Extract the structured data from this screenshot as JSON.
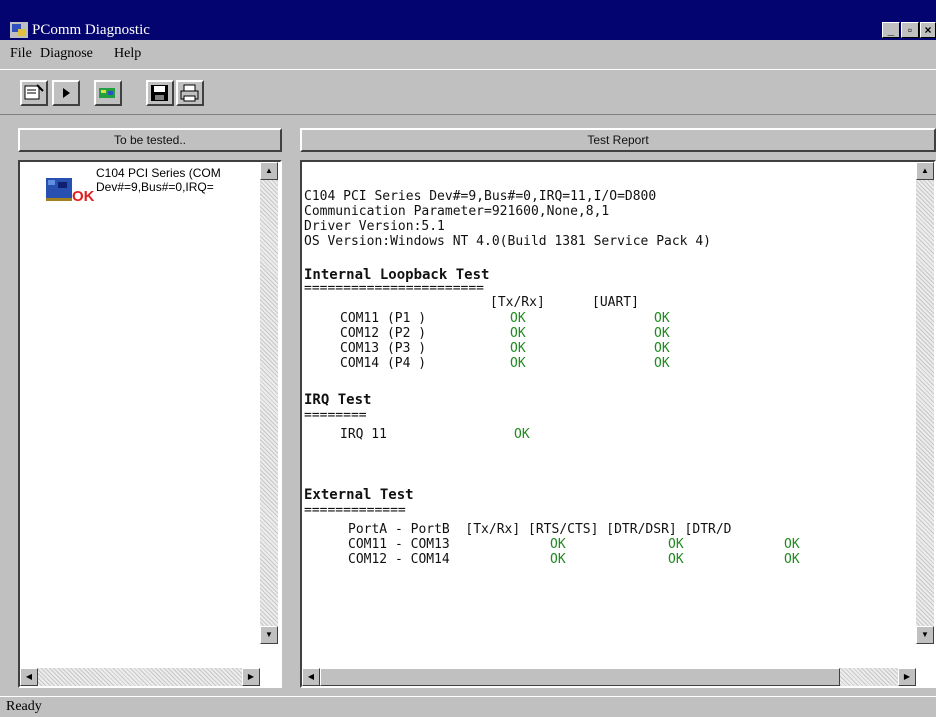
{
  "window": {
    "title": "PComm Diagnostic",
    "minimize_label": "_",
    "maximize_label": "▫",
    "close_label": "×"
  },
  "menu": [
    "File",
    "Diagnose",
    "Help"
  ],
  "toolbar": {
    "icons": [
      "properties-icon",
      "run-icon",
      "add-board-icon",
      "save-icon",
      "print-icon"
    ]
  },
  "left_panel": {
    "header": "To be tested..",
    "device": {
      "line1": "C104 PCI Series (COM",
      "line2": "Dev#=9,Bus#=0,IRQ=",
      "badge": "OK"
    }
  },
  "right_panel": {
    "header": "Test Report",
    "report": {
      "info_lines": [
        "C104 PCI Series Dev#=9,Bus#=0,IRQ=11,I/O=D800",
        "Communication Parameter=921600,None,8,1",
        "Driver Version:5.1",
        "OS Version:Windows NT 4.0(Build 1381 Service Pack 4)"
      ],
      "internal_title": "Internal Loopback Test",
      "internal_rule": "=======================",
      "internal_col1": "[Tx/Rx]",
      "internal_col2": "[UART]",
      "internal_rows": [
        {
          "port": "COM11 (P1 )",
          "txrx": "OK",
          "uart": "OK"
        },
        {
          "port": "COM12 (P2 )",
          "txrx": "OK",
          "uart": "OK"
        },
        {
          "port": "COM13 (P3 )",
          "txrx": "OK",
          "uart": "OK"
        },
        {
          "port": "COM14 (P4 )",
          "txrx": "OK",
          "uart": "OK"
        }
      ],
      "irq_title": "IRQ Test",
      "irq_rule": "========",
      "irq_label": "IRQ 11",
      "irq_result": "OK",
      "external_title": "External Test",
      "external_rule": "=============",
      "external_header": "PortA - PortB  [Tx/Rx] [RTS/CTS] [DTR/DSR] [DTR/D",
      "external_rows": [
        {
          "pair": "COM11 - COM13",
          "txrx": "OK",
          "rts": "OK",
          "dtr": "OK"
        },
        {
          "pair": "COM12 - COM14",
          "txrx": "OK",
          "rts": "OK",
          "dtr": "OK"
        }
      ]
    }
  },
  "status": "Ready",
  "colors": {
    "title_bar": "#040470",
    "ok_text": "#208a20",
    "ok_badge": "#e02020"
  }
}
